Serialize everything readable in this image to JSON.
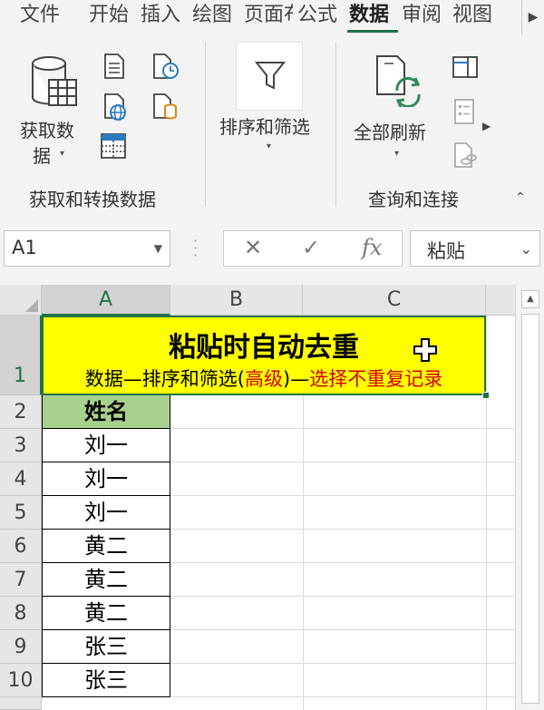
{
  "tabs": [
    {
      "label": "文件",
      "active": false
    },
    {
      "label": "开始",
      "active": false
    },
    {
      "label": "插入",
      "active": false
    },
    {
      "label": "绘图",
      "active": false
    },
    {
      "label": "页面布",
      "active": false
    },
    {
      "label": "公式",
      "active": false
    },
    {
      "label": "数据",
      "active": true
    },
    {
      "label": "审阅",
      "active": false
    },
    {
      "label": "视图",
      "active": false
    }
  ],
  "ribbon": {
    "get_data_label_line1": "获取数",
    "get_data_label_line2": "据",
    "group1_label": "获取和转换数据",
    "sort_filter_label": "排序和筛选",
    "refresh_all_label": "全部刷新",
    "group2_label": "查询和连接"
  },
  "formula_bar": {
    "name_box": "A1",
    "fx_label": "fx",
    "content": "粘贴"
  },
  "grid": {
    "columns": [
      "A",
      "B",
      "C"
    ],
    "rows": [
      "1",
      "2",
      "3",
      "4",
      "5",
      "6",
      "7",
      "8",
      "9",
      "10"
    ],
    "title_line1": "粘贴时自动去重",
    "title_line2_part1": "数据—排序和筛选(",
    "title_line2_red1": "高级",
    "title_line2_part2": ")—",
    "title_line2_red2": "选择不重复记录",
    "header_cell": "姓名",
    "names": [
      "刘一",
      "刘一",
      "刘一",
      "黄二",
      "黄二",
      "黄二",
      "张三",
      "张三"
    ]
  },
  "colors": {
    "accent": "#217346",
    "title_fill": "#ffff00",
    "header_fill": "#a9d18e",
    "red_text": "#d00000"
  }
}
